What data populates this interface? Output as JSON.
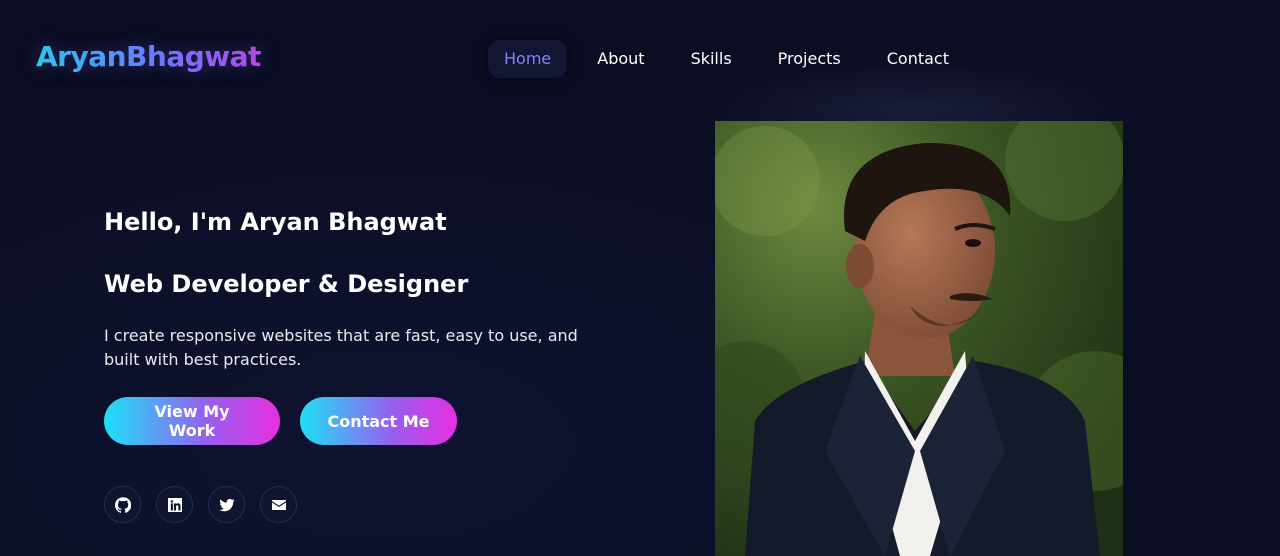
{
  "brand": {
    "logo_text": "AryanBhagwat"
  },
  "nav": {
    "items": [
      {
        "label": "Home",
        "active": true
      },
      {
        "label": "About",
        "active": false
      },
      {
        "label": "Skills",
        "active": false
      },
      {
        "label": "Projects",
        "active": false
      },
      {
        "label": "Contact",
        "active": false
      }
    ]
  },
  "hero": {
    "greeting": "Hello, I'm Aryan Bhagwat",
    "role": "Web Developer & Designer",
    "description": "I create responsive websites that are fast, easy to use, and built with best practices.",
    "primary_button": "View My Work",
    "secondary_button": "Contact Me",
    "socials": [
      "github-icon",
      "linkedin-icon",
      "twitter-icon",
      "envelope-icon"
    ],
    "photo": "portrait-photo"
  },
  "colors": {
    "background": "#0b0d22",
    "accent_cyan": "#1ee0f5",
    "accent_purple": "#9a5cf0",
    "accent_magenta": "#e62fe0",
    "nav_active": "#8f7dff"
  }
}
